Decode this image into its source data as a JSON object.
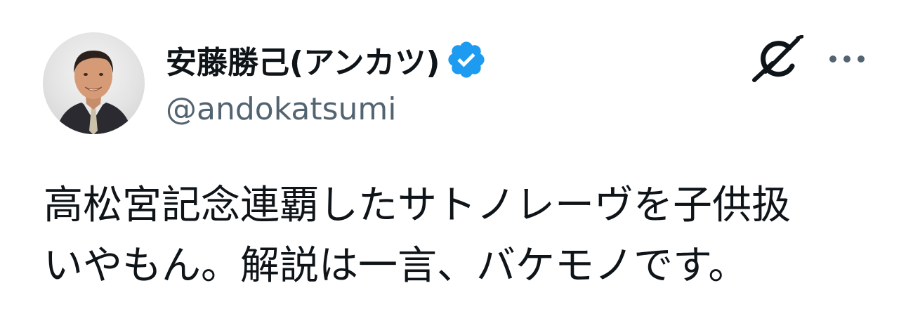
{
  "author": {
    "display_name": "安藤勝己(アンカツ)",
    "handle": "@andokatsumi",
    "verified": true,
    "verified_icon": "verified-badge-icon",
    "avatar": "profile-photo"
  },
  "actions": {
    "grok_icon": "grok-icon",
    "more_icon": "more-icon"
  },
  "tweet": {
    "text_lines": [
      "高松宮記念連覇したサトノレーヴを子供扱",
      "いやもん。解説は一言、バケモノです。"
    ]
  },
  "colors": {
    "text_primary": "#0f1419",
    "text_secondary": "#536471",
    "verified_blue": "#1d9bf0",
    "background": "#ffffff"
  }
}
